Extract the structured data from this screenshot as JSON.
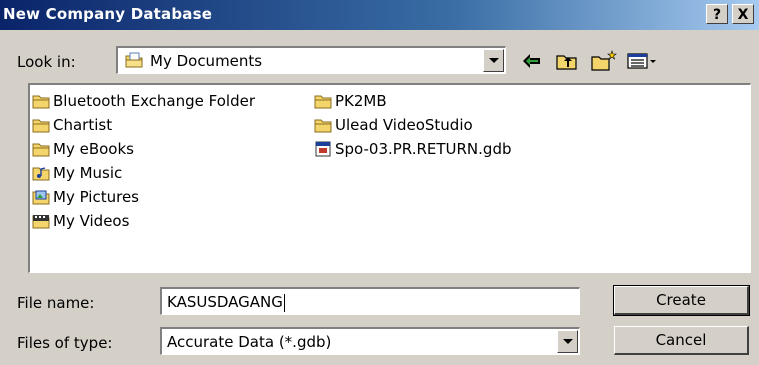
{
  "window": {
    "title": "New Company Database",
    "help_label": "?",
    "close_label": "X"
  },
  "lookin": {
    "label": "Look in:",
    "value": "My Documents"
  },
  "toolbar": {
    "back_icon": "back-arrow-icon",
    "up_icon": "up-folder-icon",
    "new_folder_icon": "new-folder-icon",
    "view_icon": "view-menu-icon"
  },
  "files": [
    {
      "name": "Bluetooth Exchange Folder",
      "icon": "folder-icon"
    },
    {
      "name": "Chartist",
      "icon": "folder-icon"
    },
    {
      "name": "My eBooks",
      "icon": "folder-icon"
    },
    {
      "name": "My Music",
      "icon": "music-folder-icon"
    },
    {
      "name": "My Pictures",
      "icon": "pictures-folder-icon"
    },
    {
      "name": "My Videos",
      "icon": "videos-folder-icon"
    },
    {
      "name": "PK2MB",
      "icon": "folder-icon"
    },
    {
      "name": "Ulead VideoStudio",
      "icon": "folder-icon"
    },
    {
      "name": "Spo-03.PR.RETURN.gdb",
      "icon": "gdb-file-icon"
    }
  ],
  "filename": {
    "label": "File name:",
    "value": "KASUSDAGANG"
  },
  "filetype": {
    "label": "Files of type:",
    "value": "Accurate Data (*.gdb)"
  },
  "buttons": {
    "create": "Create",
    "cancel": "Cancel"
  }
}
